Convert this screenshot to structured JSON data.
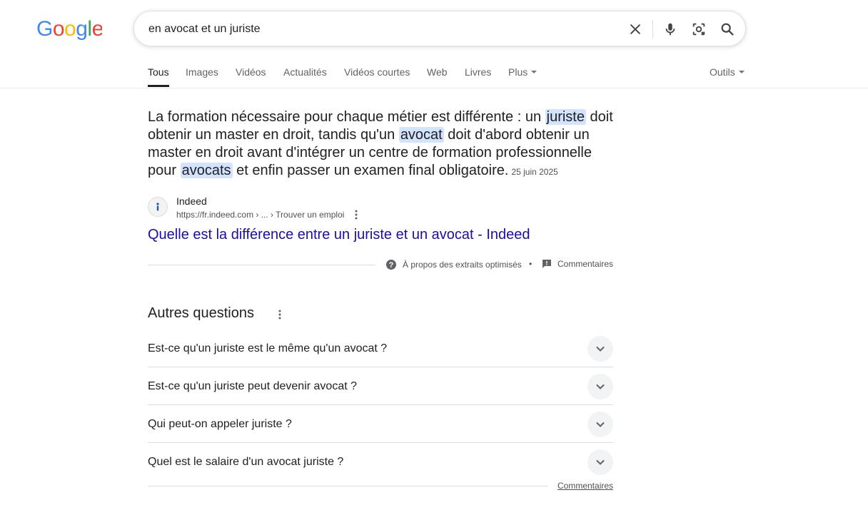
{
  "header": {
    "logo_text": "Google",
    "logo_colors": [
      "#4285F4",
      "#EA4335",
      "#FBBC05",
      "#4285F4",
      "#34A853",
      "#EA4335"
    ]
  },
  "search": {
    "query": "en avocat et un juriste",
    "icons": [
      "close-icon",
      "microphone-icon",
      "camera-lens-icon",
      "search-icon"
    ]
  },
  "tabs": {
    "items": [
      "Tous",
      "Images",
      "Vidéos",
      "Actualités",
      "Vidéos courtes",
      "Web",
      "Livres",
      "Plus"
    ],
    "active": "Tous",
    "tools": "Outils"
  },
  "featured_snippet": {
    "text_1": "La formation nécessaire pour chaque métier est différente : un ",
    "hl_1": "juriste",
    "text_2": " doit obtenir un master en droit, tandis qu'un ",
    "hl_2": "avocat",
    "text_3": " doit d'abord obtenir un master en droit avant d'intégrer un centre de formation professionnelle pour ",
    "hl_3": "avocats",
    "text_4": " et enfin passer un examen final obligatoire.",
    "date": "25 juin 2025",
    "source_name": "Indeed",
    "source_url": "https://fr.indeed.com › ... › Trouver un emploi",
    "result_title": "Quelle est la différence entre un juriste et un avocat - Indeed",
    "about_label": "À propos des extraits optimisés",
    "separator": "•",
    "feedback_label": "Commentaires"
  },
  "paa": {
    "title": "Autres questions",
    "questions": [
      "Est-ce qu'un juriste est le même qu'un avocat ?",
      "Est-ce qu'un juriste peut devenir avocat ?",
      "Qui peut-on appeler juriste ?",
      "Quel est le salaire d'un avocat juriste ?"
    ],
    "feedback_label": "Commentaires"
  },
  "colors": {
    "link": "#1a0dab",
    "highlight": "#d3e3fd",
    "text": "#202124",
    "secondary": "#4d5156"
  }
}
